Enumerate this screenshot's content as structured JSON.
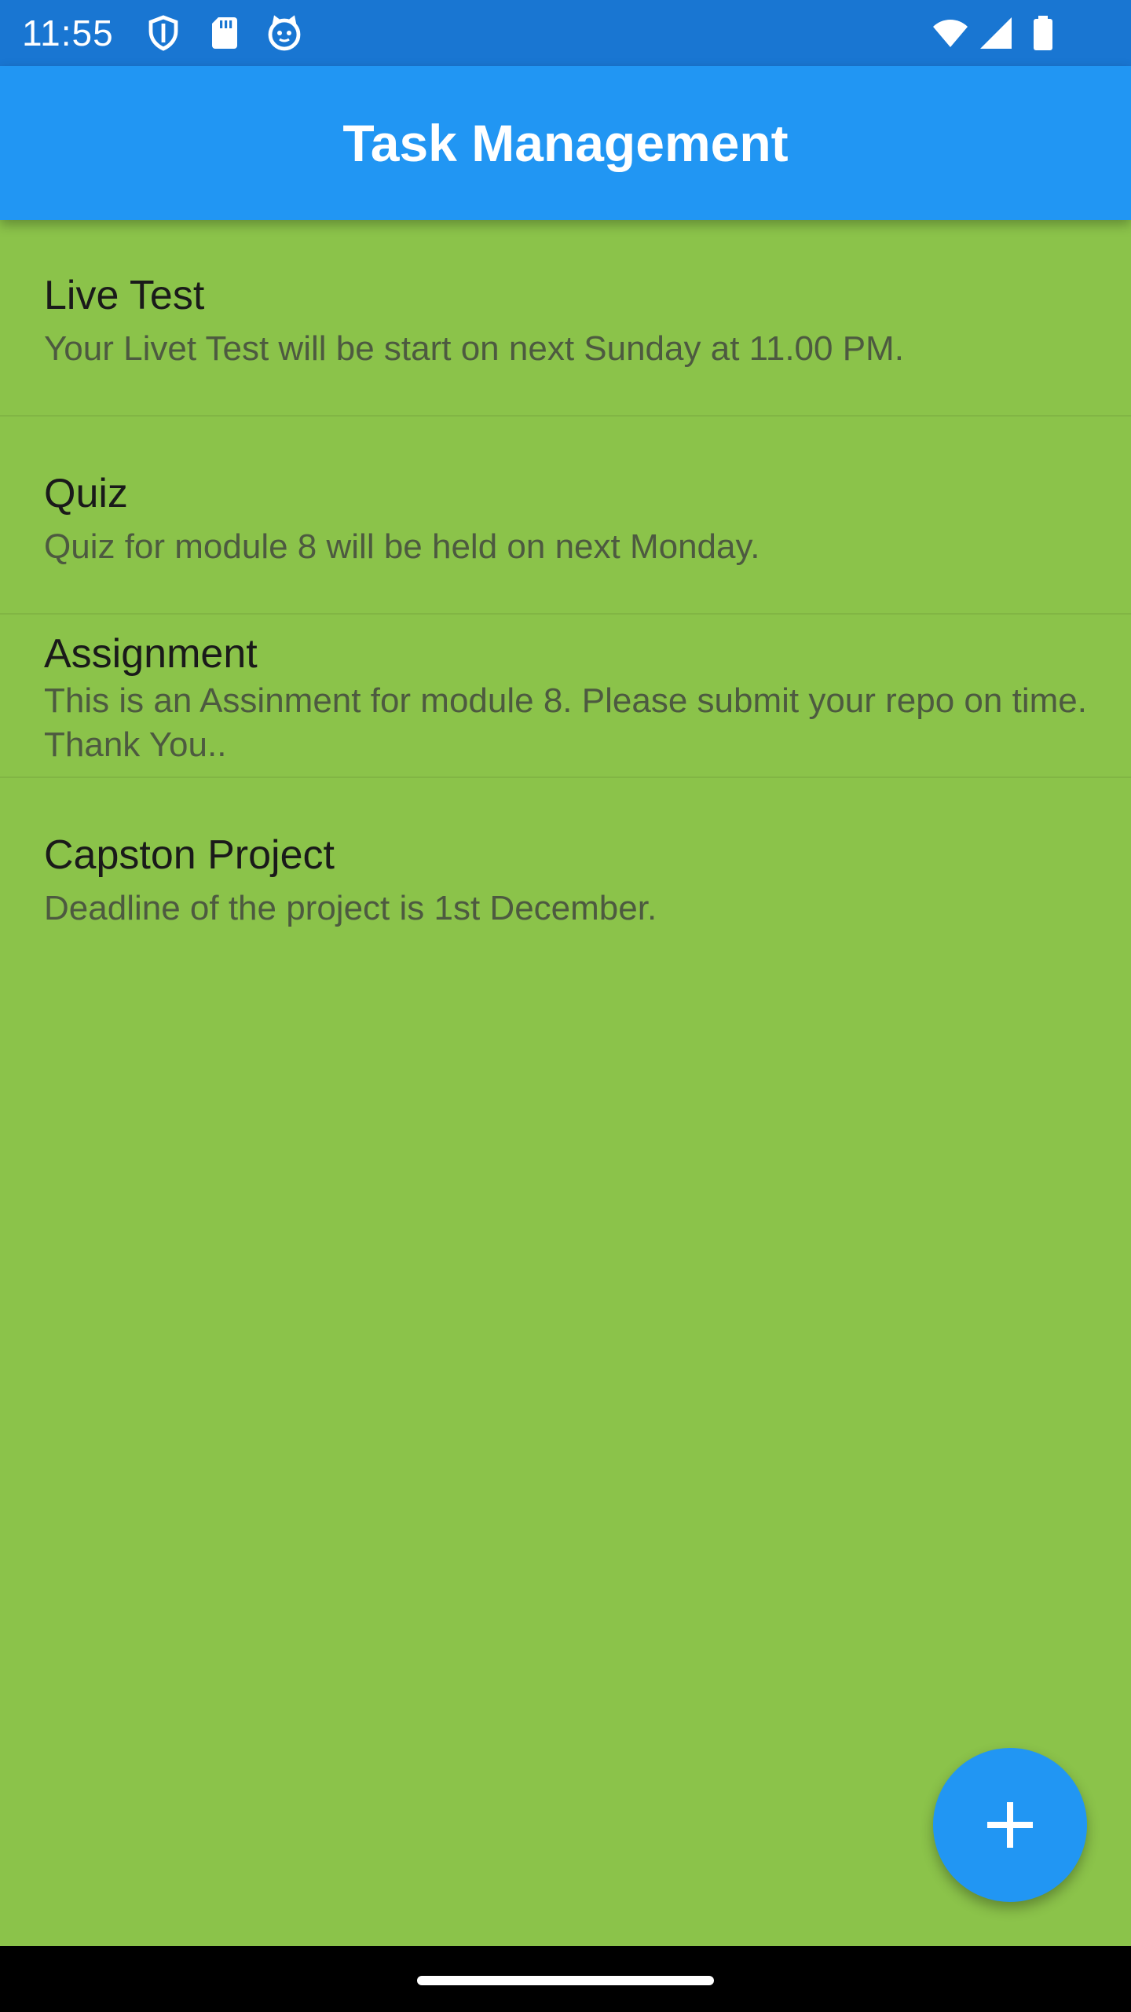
{
  "status_bar": {
    "time": "11:55",
    "icons": [
      "shield-icon",
      "sd-card-icon",
      "cat-face-icon",
      "wifi-icon",
      "cellular-signal-icon",
      "battery-icon"
    ]
  },
  "app_bar": {
    "title": "Task Management"
  },
  "tasks": [
    {
      "title": "Live Test",
      "description": "Your Livet Test will be start on next Sunday at 11.00 PM."
    },
    {
      "title": "Quiz",
      "description": "Quiz for module 8 will be held on next Monday."
    },
    {
      "title": "Assignment",
      "description": "This is an Assinment for module 8. Please submit your repo on time. Thank You.."
    },
    {
      "title": "Capston Project",
      "description": "Deadline of the project is 1st December."
    }
  ],
  "fab": {
    "icon": "add-icon"
  },
  "colors": {
    "status_bar": "#1976D2",
    "app_bar": "#2196F3",
    "background": "#8BC34A",
    "fab": "#2196F3"
  }
}
